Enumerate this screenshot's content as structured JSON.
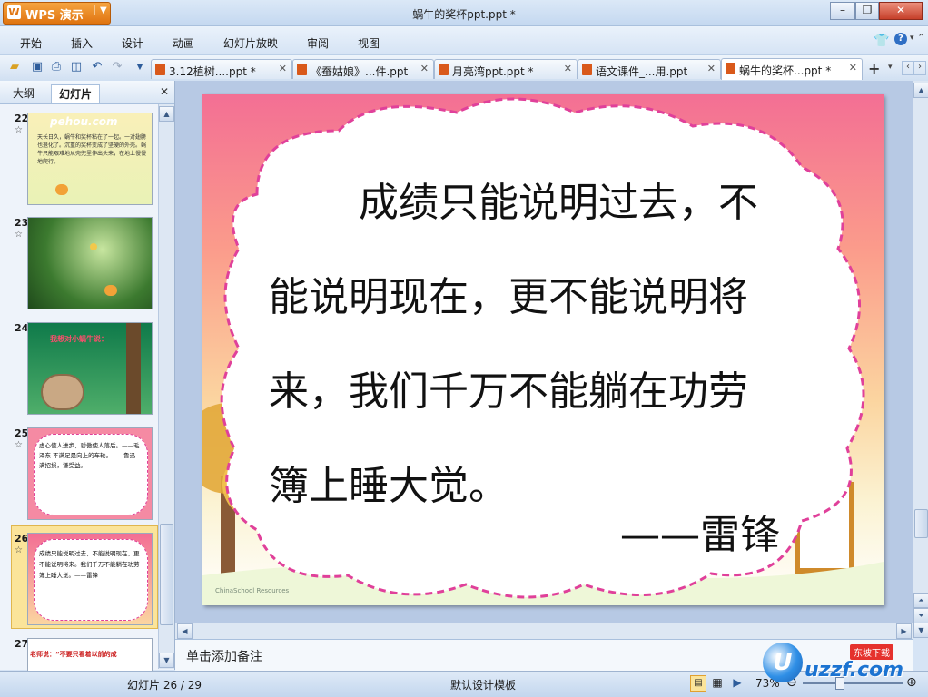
{
  "app": {
    "name": "WPS 演示",
    "doc_title": "蜗牛的奖杯ppt.ppt *"
  },
  "menu": [
    "开始",
    "插入",
    "设计",
    "动画",
    "幻灯片放映",
    "审阅",
    "视图"
  ],
  "doc_tabs": [
    {
      "label": "3.12植树....ppt *"
    },
    {
      "label": "《蚕姑娘》...件.ppt"
    },
    {
      "label": "月亮湾ppt.ppt *"
    },
    {
      "label": "语文课件_...用.ppt"
    },
    {
      "label": "蜗牛的奖杯...ppt *"
    }
  ],
  "left_panel": {
    "tabs": [
      "大纲",
      "幻灯片"
    ],
    "slides": [
      {
        "num": "22",
        "star": "☆",
        "caption": "pehou.com",
        "text": "天长日久，蜗牛和奖杯粘在了一起。一对翅膀也退化了。沉重的奖杯变成了坚硬的外壳。蜗牛只能艰难地从壳兜里伸出头来，在地上慢慢地爬行。"
      },
      {
        "num": "23",
        "star": "☆"
      },
      {
        "num": "24",
        "star": "",
        "caption": "我想对小蜗牛说："
      },
      {
        "num": "25",
        "star": "☆",
        "text": "虚心使人进步，骄傲使人落后。——毛泽东 不满足是向上的车轮。——鲁迅 满招损，谦受益。"
      },
      {
        "num": "26",
        "star": "☆",
        "text": "成绩只能说明过去，不能说明现在，更不能说明将来。我们千万不能躺在功劳簿上睡大觉。——雷锋"
      },
      {
        "num": "27",
        "star": "",
        "caption": "老师说：“不要只看着以前的成"
      }
    ]
  },
  "slide": {
    "lines": [
      "成绩只能说明过去，不",
      "能说明现在，更不能说明将",
      "来，我们千万不能躺在功劳",
      "簿上睡大觉。"
    ],
    "author": "——雷锋",
    "watermark": "ChinaSchool Resources"
  },
  "notes_placeholder": "单击添加备注",
  "status": {
    "slide_counter": "幻灯片 26 / 29",
    "template": "默认设计模板",
    "zoom": "73%"
  },
  "badge": {
    "text": "uzzf.com",
    "sub": "东坡下载"
  },
  "colors": {
    "accent": "#e07410",
    "tab_border": "#a9c0dd",
    "cloud_dash": "#e0409a"
  }
}
